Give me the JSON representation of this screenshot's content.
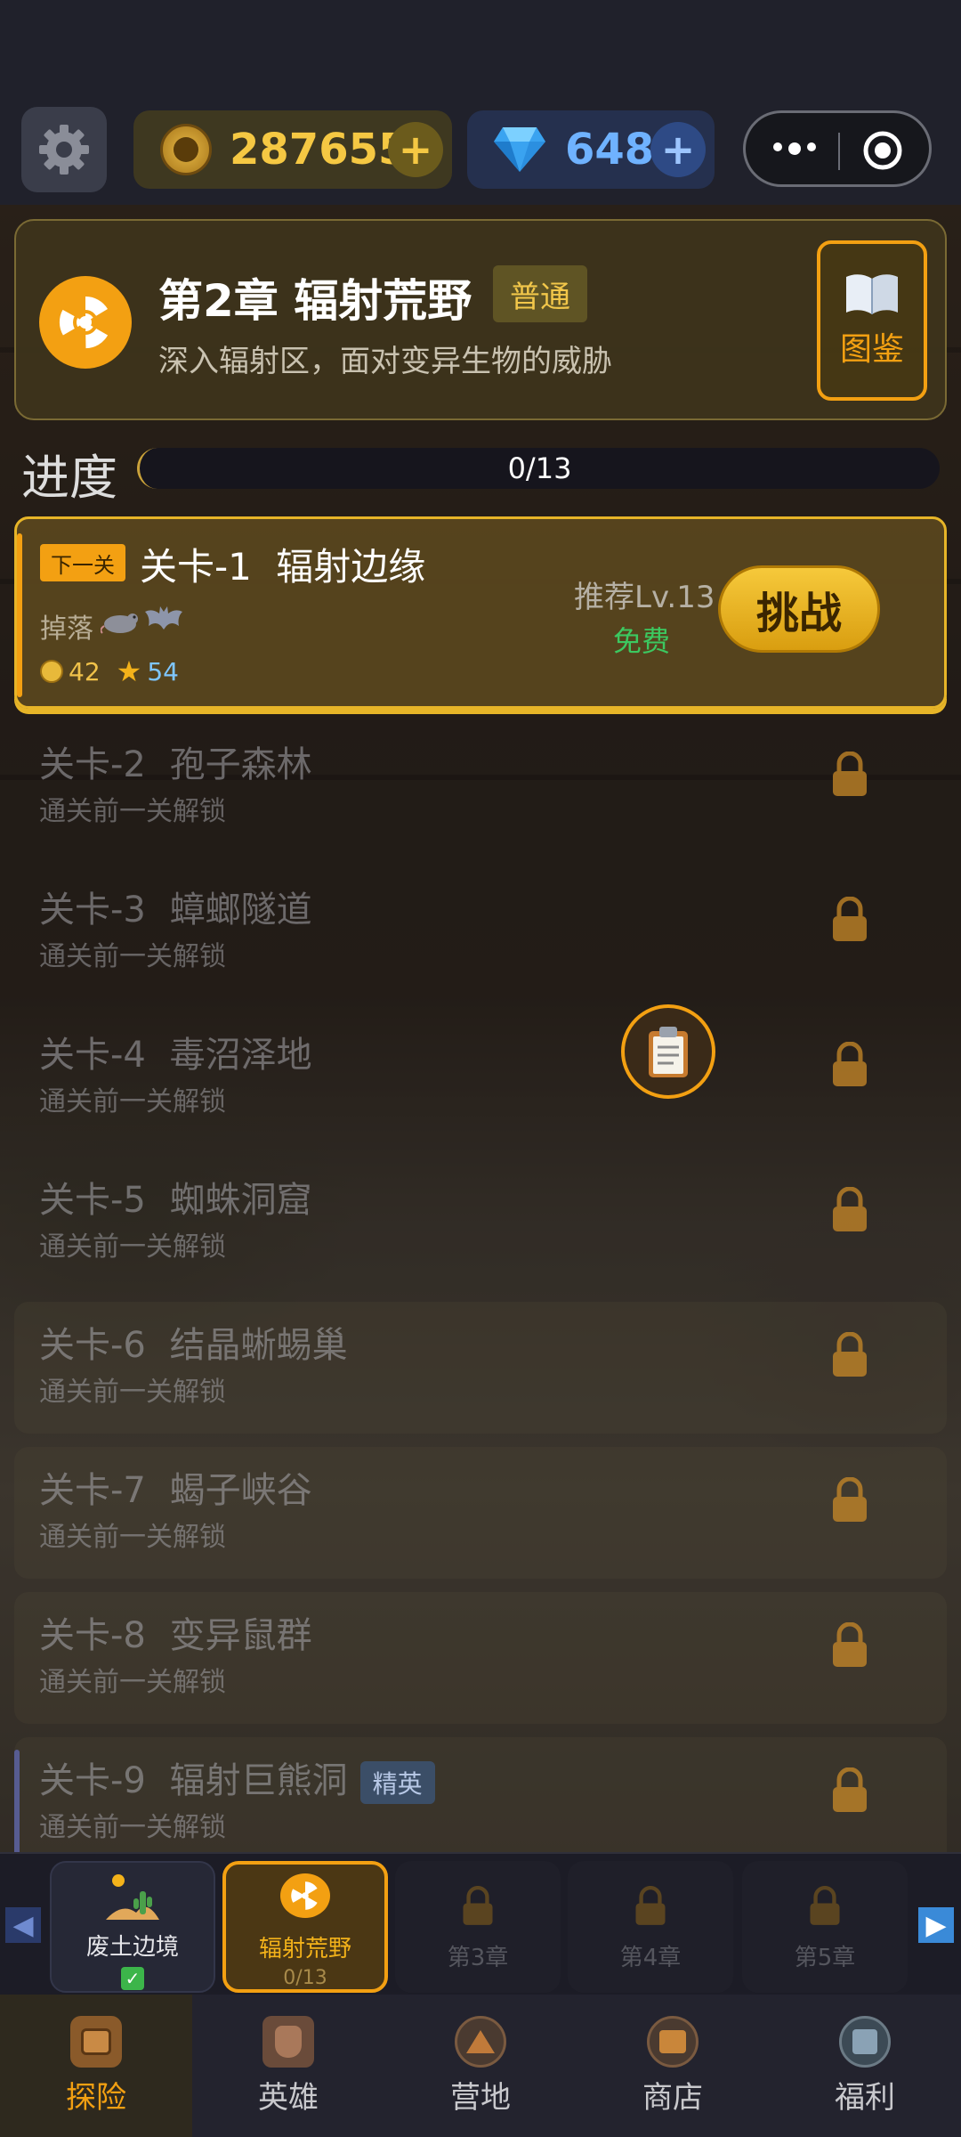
{
  "currency": {
    "coins": "287655",
    "gems": "648"
  },
  "chapter": {
    "title": "第2章 辐射荒野",
    "mode": "普通",
    "description": "深入辐射区，面对变异生物的威胁",
    "codex_label": "图鉴"
  },
  "progress": {
    "label": "进度",
    "value": "0/13",
    "fraction": 0
  },
  "current_stage": {
    "tag": "下一关",
    "name": "关卡-1 辐射边缘",
    "drop_label": "掉落",
    "coins": "42",
    "stars": "54",
    "recommend": "推荐Lv.13",
    "cost": "免费",
    "challenge": "挑战"
  },
  "locked_stages": [
    {
      "name": "关卡-2 孢子森林",
      "hint": "通关前一关解锁"
    },
    {
      "name": "关卡-3 蟑螂隧道",
      "hint": "通关前一关解锁"
    },
    {
      "name": "关卡-4 毒沼泽地",
      "hint": "通关前一关解锁"
    },
    {
      "name": "关卡-5 蜘蛛洞窟",
      "hint": "通关前一关解锁"
    },
    {
      "name": "关卡-6 结晶蜥蜴巢",
      "hint": "通关前一关解锁"
    },
    {
      "name": "关卡-7 蝎子峡谷",
      "hint": "通关前一关解锁"
    },
    {
      "name": "关卡-8 变异鼠群",
      "hint": "通关前一关解锁"
    },
    {
      "name": "关卡-9 辐射巨熊洞",
      "hint": "通关前一关解锁",
      "badge": "精英"
    }
  ],
  "chapter_tabs": [
    {
      "label": "废土边境",
      "status": "cleared"
    },
    {
      "label": "辐射荒野",
      "sub": "0/13",
      "status": "current"
    },
    {
      "label": "第3章",
      "status": "locked"
    },
    {
      "label": "第4章",
      "status": "locked"
    },
    {
      "label": "第5章",
      "status": "locked"
    }
  ],
  "bottom_nav": [
    {
      "label": "探险",
      "icon": "backpack-icon",
      "active": true
    },
    {
      "label": "英雄",
      "icon": "hero-icon"
    },
    {
      "label": "营地",
      "icon": "camp-icon"
    },
    {
      "label": "商店",
      "icon": "shop-icon"
    },
    {
      "label": "福利",
      "icon": "gift-icon"
    }
  ],
  "colors": {
    "accent": "#f3a012",
    "gold": "#e7b528",
    "free_green": "#3cc860"
  }
}
